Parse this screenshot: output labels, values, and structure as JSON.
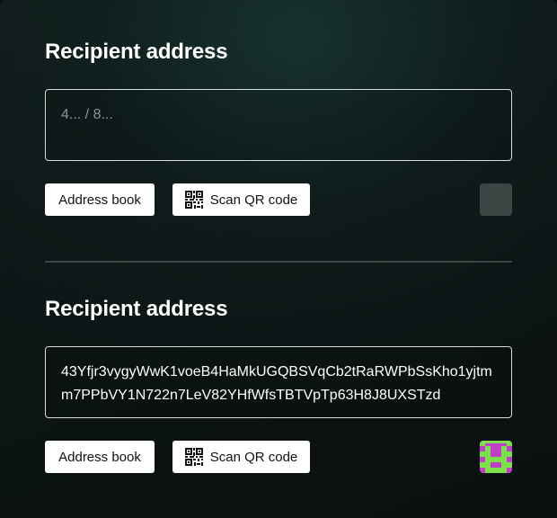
{
  "section1": {
    "title": "Recipient address",
    "placeholder": "4... / 8...",
    "address_book_label": "Address book",
    "scan_qr_label": "Scan QR code"
  },
  "section2": {
    "title": "Recipient address",
    "value": "43Yfjr3vygyWwK1voeB4HaMkUGQBSVqCb2tRaRWPbSsKho1yjtmm7PPbVY1N722n7LeV82YHfWfsTBTVpTp63H8J8UXSTzd",
    "address_book_label": "Address book",
    "scan_qr_label": "Scan QR code"
  },
  "colors": {
    "avatar_green": "#7be04a",
    "avatar_magenta": "#c03ec8",
    "empty_avatar": "#3b4544"
  }
}
